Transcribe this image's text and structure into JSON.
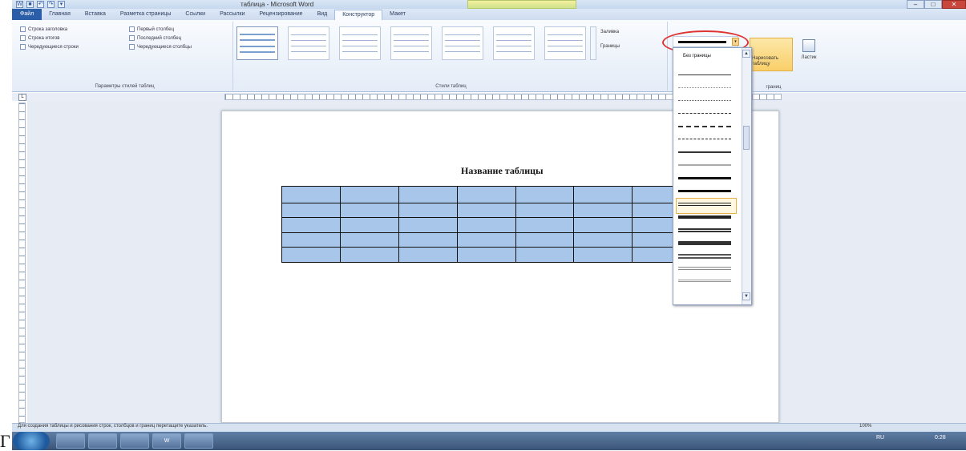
{
  "window": {
    "title": "таблица - Microsoft Word",
    "qat_icons": [
      "word-app-icon",
      "save-icon",
      "undo-icon",
      "redo-icon",
      "customize-icon"
    ],
    "qat_glyphs": [
      "W",
      "■",
      "↶",
      "↷",
      "▾"
    ],
    "contextual_label": "",
    "controls": {
      "minimize": "–",
      "maximize": "□",
      "close": "✕"
    }
  },
  "tabs": [
    {
      "label": "Файл"
    },
    {
      "label": "Главная"
    },
    {
      "label": "Вставка"
    },
    {
      "label": "Разметка страницы"
    },
    {
      "label": "Ссылки"
    },
    {
      "label": "Рассылки"
    },
    {
      "label": "Рецензирование"
    },
    {
      "label": "Вид"
    },
    {
      "label": "Конструктор"
    },
    {
      "label": "Макет"
    }
  ],
  "ribbon": {
    "options": {
      "items": [
        "Строка заголовка",
        "Строка итогов",
        "Чередующиеся строки",
        "Первый столбец",
        "Последний столбец",
        "Чередующиеся столбцы"
      ],
      "group_label": "Параметры стилей таблиц"
    },
    "styles": {
      "group_label": "Стили таблиц"
    },
    "shading_label": "Заливка",
    "borders_label": "Границы",
    "draw": {
      "draw_label": "Нарисовать таблицу",
      "eraser_label": "Ластик",
      "group_label": "границ"
    }
  },
  "dropdown": {
    "no_border": "Без границы",
    "up": "▲",
    "down": "▼",
    "arrow": "▾"
  },
  "document": {
    "table_title": "Название таблицы",
    "rows": 5,
    "cols": 8,
    "cell_color": "#a8c6ea"
  },
  "status": {
    "text": "Для создания таблицы и рисования строк, столбцов и границ перетащите указатель.",
    "zoom": "100%"
  },
  "taskbar": {
    "lang": "RU",
    "time": "0:28",
    "items": [
      "browser",
      "explorer",
      "media",
      "Word",
      "app"
    ]
  },
  "corner_text": "Г"
}
